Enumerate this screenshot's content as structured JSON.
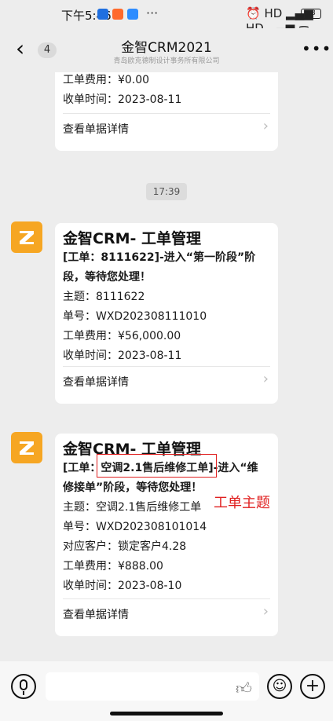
{
  "status": {
    "time": "下午5:46",
    "dots": "···",
    "right_icons": "⏰ HD ▂▄▆ HD ▂▄▆ ᯤ",
    "battery": "68"
  },
  "nav": {
    "back_count": "4",
    "title": "金智CRM2021",
    "subtitle": "青岛欧克德制设计事务所有限公司"
  },
  "messages": {
    "card0": {
      "fee": "工单费用：¥0.00",
      "date": "收单时间：2023-08-11",
      "link": "查看单据详情"
    },
    "timestamp": "17:39",
    "card1": {
      "title": "金智CRM- 工单管理",
      "line1": "[工单：8111622]-进入“第一阶段”阶",
      "line2": "段，等待您处理！",
      "subject": "主题：8111622",
      "number": "单号：WXD202308111010",
      "fee": "工单费用：¥56,000.00",
      "date": "收单时间：2023-08-11",
      "link": "查看单据详情"
    },
    "card2": {
      "title": "金智CRM- 工单管理",
      "line1": "[工单：空调2.1售后维修工单]-进入“维",
      "line2": "修接单”阶段，等待您处理！",
      "subject": "主题：空调2.1售后维修工单",
      "number": "单号：WXD202308101014",
      "customer": "对应客户：锁定客户4.28",
      "fee": "工单费用：¥888.00",
      "date": "收单时间：2023-08-10",
      "link": "查看单据详情"
    }
  },
  "annotation": "工单主题",
  "colors": {
    "background": "#ededed",
    "avatar": "#f6a623",
    "annotation": "#e02020"
  }
}
